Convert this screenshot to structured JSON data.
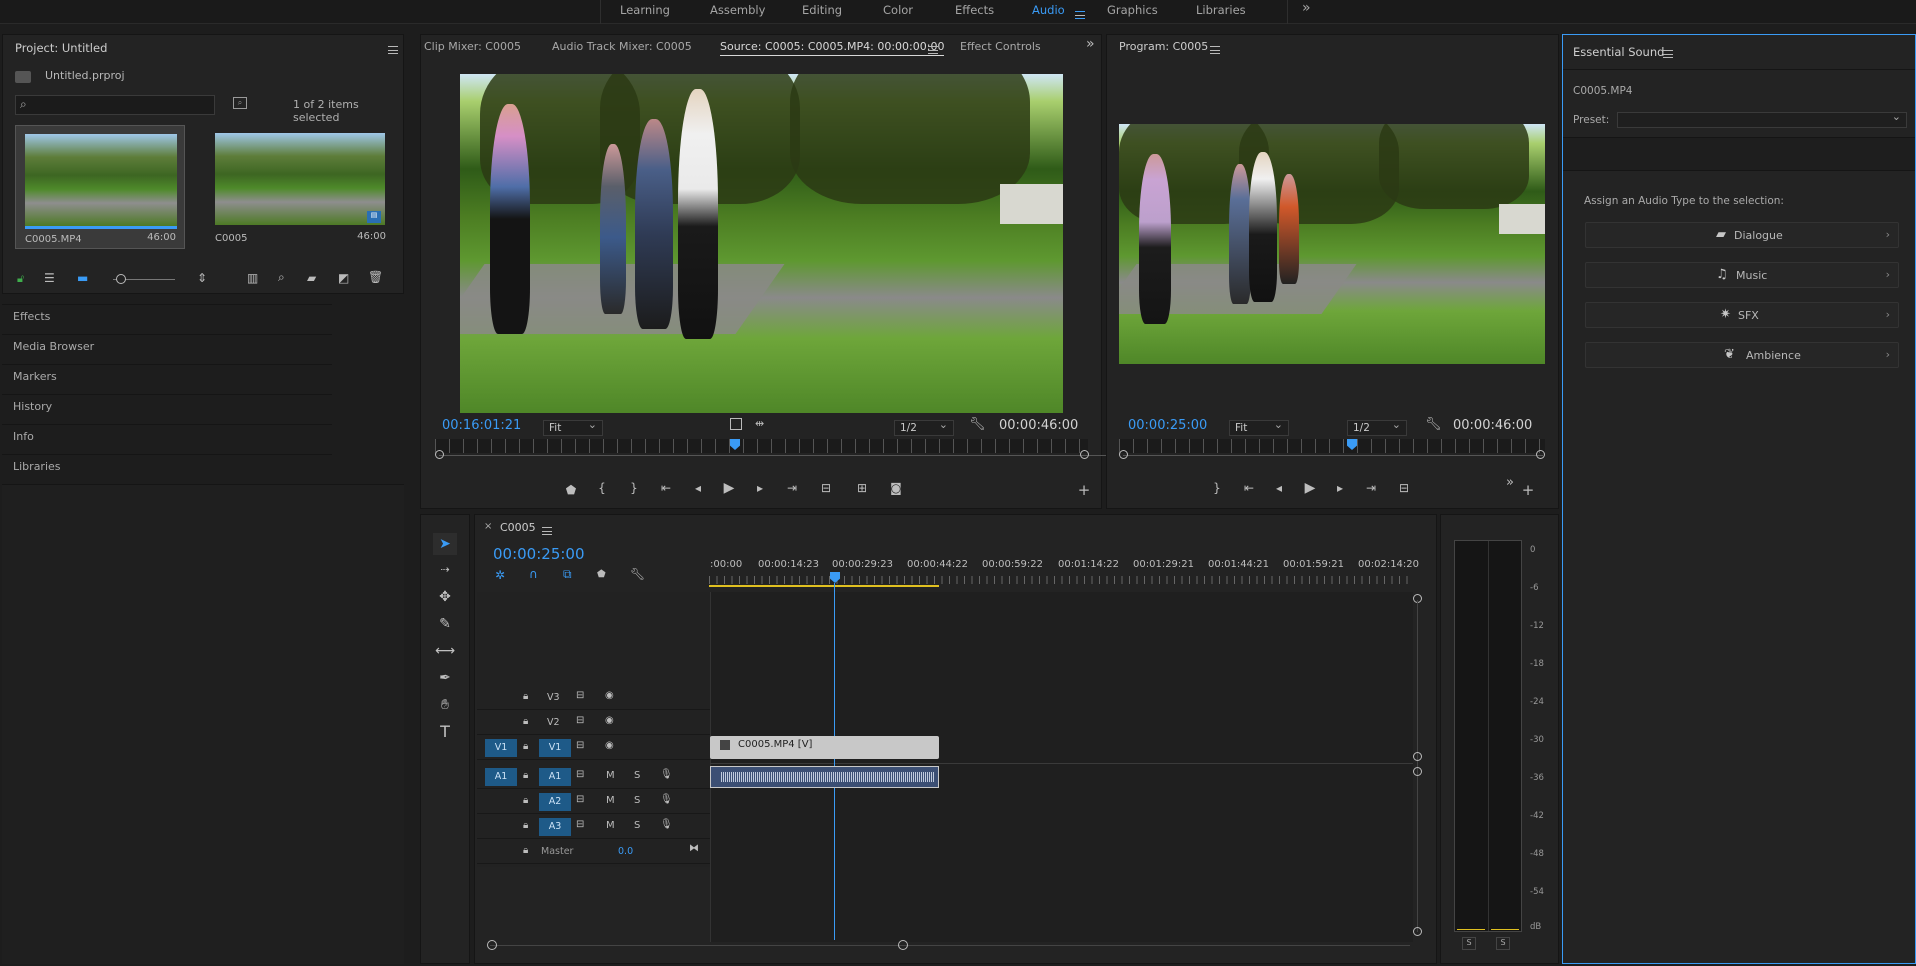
{
  "workspaces": {
    "tabs": [
      {
        "label": "Learning"
      },
      {
        "label": "Assembly"
      },
      {
        "label": "Editing"
      },
      {
        "label": "Color"
      },
      {
        "label": "Effects"
      },
      {
        "label": "Audio"
      },
      {
        "label": "Graphics"
      },
      {
        "label": "Libraries"
      }
    ],
    "active": "Audio",
    "overflow_icon": "chevron-double-right-icon"
  },
  "project": {
    "title": "Project: Untitled",
    "file": "Untitled.prproj",
    "search_placeholder": "",
    "selection_status": "1 of 2 items selected",
    "items": [
      {
        "name": "C0005.MP4",
        "duration": "46:00"
      },
      {
        "name": "C0005",
        "duration": "46:00"
      }
    ]
  },
  "left_panels": [
    "Effects",
    "Media Browser",
    "Markers",
    "History",
    "Info",
    "Libraries"
  ],
  "source_monitor": {
    "tabs": [
      "Clip Mixer: C0005",
      "Audio Track Mixer: C0005",
      "Source: C0005: C0005.MP4: 00:00:00:00",
      "Effect Controls"
    ],
    "active_tab": "Source: C0005: C0005.MP4: 00:00:00:00",
    "timecode": "00:16:01:21",
    "zoom": "Fit",
    "resolution": "1/2",
    "duration": "00:00:46:00"
  },
  "program_monitor": {
    "title": "Program: C0005",
    "timecode": "00:00:25:00",
    "zoom": "Fit",
    "resolution": "1/2",
    "duration": "00:00:46:00"
  },
  "essential_sound": {
    "title": "Essential Sound",
    "clip": "C0005.MP4",
    "preset_label": "Preset:",
    "preset_value": "",
    "assign_text": "Assign an Audio Type to the selection:",
    "types": [
      {
        "label": "Dialogue",
        "icon": "speech-bubble-icon"
      },
      {
        "label": "Music",
        "icon": "music-note-icon"
      },
      {
        "label": "SFX",
        "icon": "burst-icon"
      },
      {
        "label": "Ambience",
        "icon": "leaf-icon"
      }
    ]
  },
  "timeline": {
    "sequence": "C0005",
    "timecode": "00:00:25:00",
    "ruler": [
      ":00:00",
      "00:00:14:23",
      "00:00:29:23",
      "00:00:44:22",
      "00:00:59:22",
      "00:01:14:22",
      "00:01:29:21",
      "00:01:44:21",
      "00:01:59:21",
      "00:02:14:20"
    ],
    "video_tracks": [
      {
        "name": "V3",
        "target": ""
      },
      {
        "name": "V2",
        "target": ""
      },
      {
        "name": "V1",
        "target": "V1"
      }
    ],
    "audio_tracks": [
      {
        "name": "A1",
        "target": "A1",
        "m": "M",
        "s": "S"
      },
      {
        "name": "A2",
        "target": "",
        "m": "M",
        "s": "S"
      },
      {
        "name": "A3",
        "target": "",
        "m": "M",
        "s": "S"
      }
    ],
    "master": {
      "label": "Master",
      "value": "0.0"
    },
    "video_clip": "C0005.MP4 [V]"
  },
  "meter": {
    "labels": [
      "0",
      "-6",
      "-12",
      "-18",
      "-24",
      "-30",
      "-36",
      "-42",
      "-48",
      "-54",
      "dB"
    ],
    "solo": [
      "S",
      "S"
    ]
  },
  "colors": {
    "accent": "#3a9bf5",
    "track_target": "#1e5a88"
  }
}
